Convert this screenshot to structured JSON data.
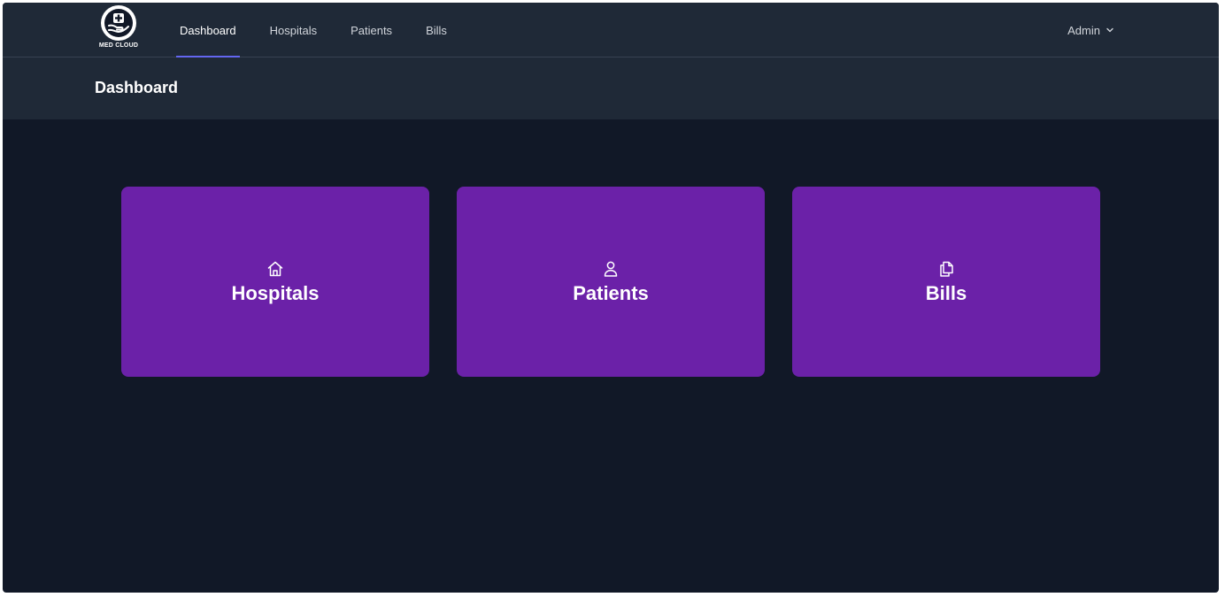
{
  "brand": {
    "name": "MED CLOUD",
    "icon": "medical-hand-icon"
  },
  "nav": {
    "items": [
      {
        "label": "Dashboard",
        "active": true
      },
      {
        "label": "Hospitals",
        "active": false
      },
      {
        "label": "Patients",
        "active": false
      },
      {
        "label": "Bills",
        "active": false
      }
    ]
  },
  "user_menu": {
    "label": "Admin",
    "icon": "chevron-down-icon"
  },
  "header": {
    "title": "Dashboard"
  },
  "cards": [
    {
      "label": "Hospitals",
      "icon": "home-icon"
    },
    {
      "label": "Patients",
      "icon": "user-icon"
    },
    {
      "label": "Bills",
      "icon": "documents-icon"
    }
  ],
  "colors": {
    "background": "#111827",
    "navbar": "#1f2937",
    "card": "#6b21a8",
    "active_indicator": "#6366f1"
  }
}
